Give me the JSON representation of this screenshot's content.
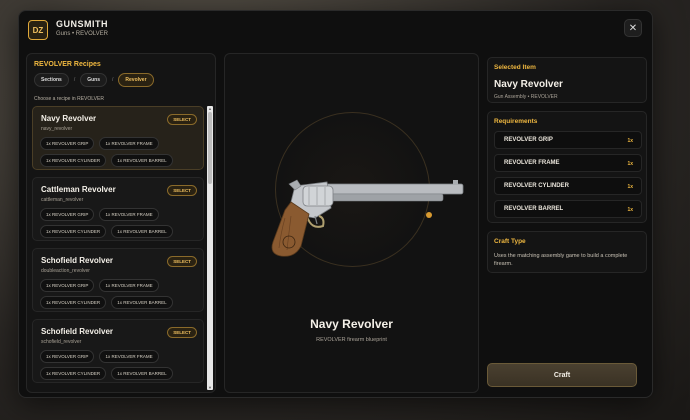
{
  "header": {
    "logo_text": "DZ",
    "title": "GUNSMITH",
    "breadcrumb": "Guns • REVOLVER",
    "close_label": "✕"
  },
  "left": {
    "title": "REVOLVER Recipes",
    "crumbs": [
      "Sections",
      "Guns",
      "Revolver"
    ],
    "crumb_sep": "/",
    "choose_text": "Choose a recipe in REVOLVER",
    "select_label": "SELECT",
    "recipes": [
      {
        "name": "Navy Revolver",
        "id": "navy_revolver",
        "parts": [
          "1x REVOLVER GRIP",
          "1x REVOLVER FRAME",
          "1x REVOLVER CYLINDER",
          "1x REVOLVER BARREL"
        ]
      },
      {
        "name": "Cattleman Revolver",
        "id": "cattleman_revolver",
        "parts": [
          "1x REVOLVER GRIP",
          "1x REVOLVER FRAME",
          "1x REVOLVER CYLINDER",
          "1x REVOLVER BARREL"
        ]
      },
      {
        "name": "Schofield Revolver",
        "id": "doubleaction_revolver",
        "parts": [
          "1x REVOLVER GRIP",
          "1x REVOLVER FRAME",
          "1x REVOLVER CYLINDER",
          "1x REVOLVER BARREL"
        ]
      },
      {
        "name": "Schofield Revolver",
        "id": "schofield_revolver",
        "parts": [
          "1x REVOLVER GRIP",
          "1x REVOLVER FRAME",
          "1x REVOLVER CYLINDER",
          "1x REVOLVER BARREL"
        ]
      }
    ]
  },
  "preview": {
    "name": "Navy Revolver",
    "subtitle": "REVOLVER firearm blueprint"
  },
  "selected": {
    "label": "Selected Item",
    "name": "Navy Revolver",
    "sub": "Gun Assembly • REVOLVER"
  },
  "requirements": {
    "label": "Requirements",
    "items": [
      {
        "name": "REVOLVER GRIP",
        "qty": "1x"
      },
      {
        "name": "REVOLVER FRAME",
        "qty": "1x"
      },
      {
        "name": "REVOLVER CYLINDER",
        "qty": "1x"
      },
      {
        "name": "REVOLVER BARREL",
        "qty": "1x"
      }
    ]
  },
  "craft_type": {
    "label": "Craft Type",
    "text": "Uses the matching assembly game to build a complete firearm."
  },
  "craft_button": "Craft",
  "colors": {
    "accent": "#f0b840",
    "panel": "#141414"
  }
}
